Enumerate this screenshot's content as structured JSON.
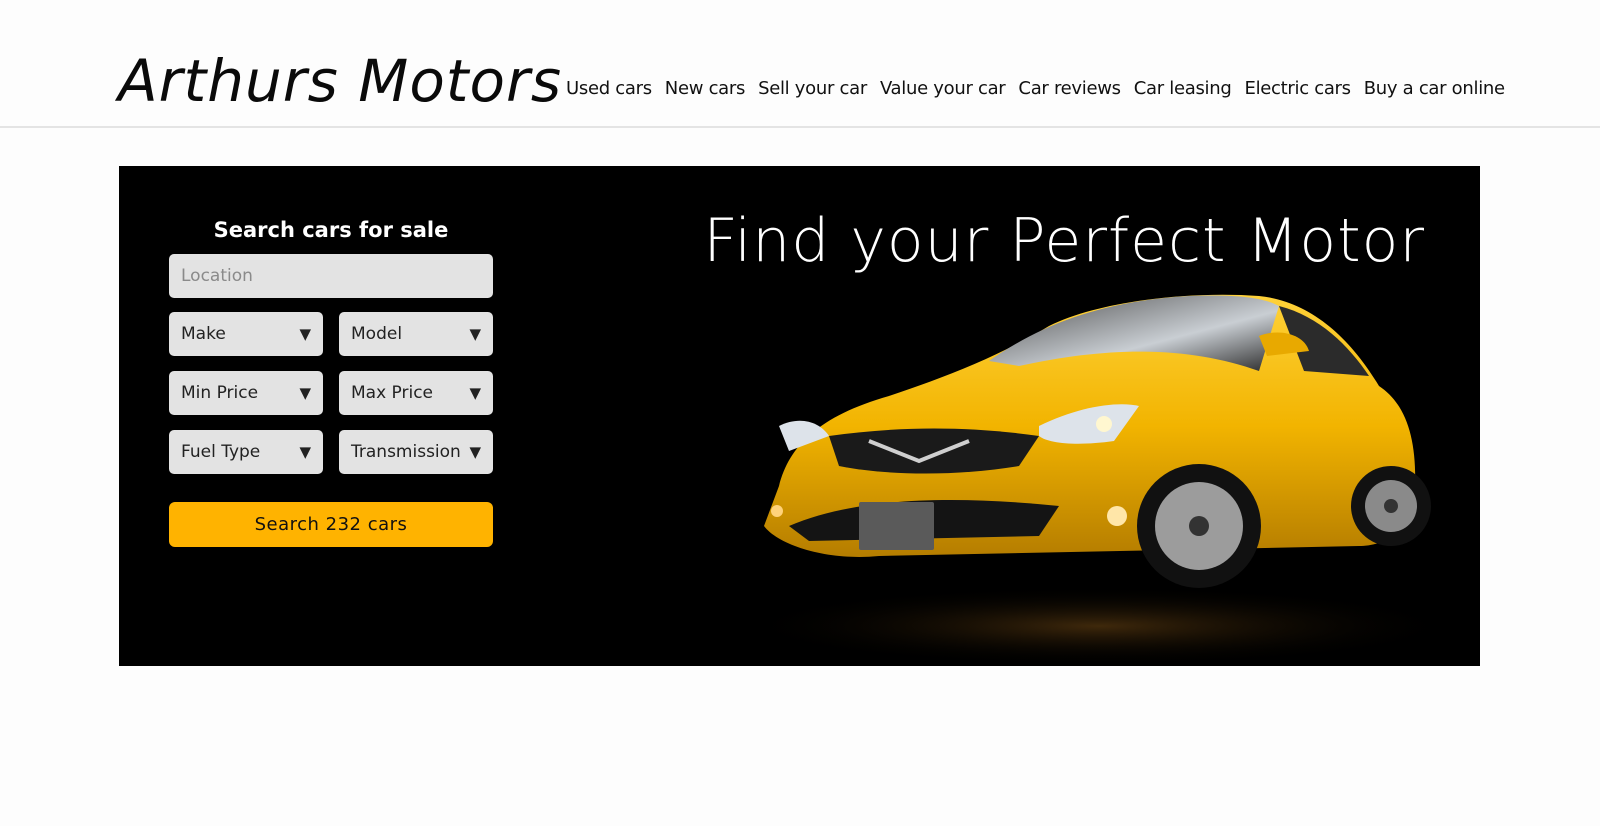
{
  "header": {
    "logo": "Arthurs Motors",
    "nav": [
      {
        "label": "Used cars"
      },
      {
        "label": "New cars"
      },
      {
        "label": "Sell your car"
      },
      {
        "label": "Value your car"
      },
      {
        "label": "Car reviews"
      },
      {
        "label": "Car leasing"
      },
      {
        "label": "Electric cars"
      },
      {
        "label": "Buy a car online"
      }
    ]
  },
  "hero": {
    "title": "Find your Perfect Motor"
  },
  "search": {
    "title": "Search cars for sale",
    "location_placeholder": "Location",
    "make": "Make",
    "model": "Model",
    "min_price": "Min Price",
    "max_price": "Max Price",
    "fuel_type": "Fuel Type",
    "transmission": "Transmission",
    "dropdown_arrow": "▼",
    "button_label": "Search 232 cars"
  },
  "colors": {
    "accent": "#ffb300",
    "hero_bg": "#000000",
    "field_bg": "#e3e3e3",
    "car_body": "#f2b400"
  },
  "icons": {
    "dropdown": "chevron-down-icon"
  }
}
